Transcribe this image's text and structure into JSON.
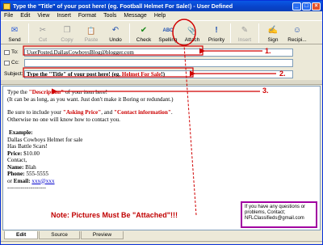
{
  "window": {
    "title": "Type the \"Title\" of your post here! (eg. Football Helmet For Sale!) - User Defined",
    "buttons": [
      "_",
      "□",
      "×"
    ]
  },
  "menu": [
    "File",
    "Edit",
    "View",
    "Insert",
    "Format",
    "Tools",
    "Message",
    "Help"
  ],
  "toolbar": [
    {
      "label": "Send",
      "icon": "send-icon",
      "glyph": "✉"
    },
    {
      "label": "Cut",
      "icon": "scissors-icon",
      "glyph": "✂",
      "disabled": true
    },
    {
      "label": "Copy",
      "icon": "copy-icon",
      "glyph": "❐",
      "disabled": true
    },
    {
      "label": "Paste",
      "icon": "paste-icon",
      "glyph": "📋",
      "disabled": true
    },
    {
      "label": "Undo",
      "icon": "undo-icon",
      "glyph": "↶"
    },
    {
      "label": "Check",
      "icon": "check-names-icon",
      "glyph": "✔"
    },
    {
      "label": "Spelling",
      "icon": "spelling-icon",
      "glyph": "ABC"
    },
    {
      "label": "Attach",
      "icon": "paperclip-icon",
      "glyph": "📎"
    },
    {
      "label": "Priority",
      "icon": "priority-icon",
      "glyph": "!"
    },
    {
      "label": "Insert",
      "icon": "insert-icon",
      "glyph": "✎",
      "disabled": true
    },
    {
      "label": "Sign",
      "icon": "sign-icon",
      "glyph": "✍"
    },
    {
      "label": "Recipi...",
      "icon": "recipients-icon",
      "glyph": "☺"
    }
  ],
  "headers": {
    "to_label": "To:",
    "to_value": "UserPosted.DallasCowboysBlog@blogger.com",
    "cc_label": "Cc:",
    "cc_value": "",
    "subject_label": "Subject:",
    "subject_value_pre": "Type the \"Title\" of your post here! (eg. ",
    "subject_value_red": "Helmet For Sale",
    "subject_value_post": "!)"
  },
  "body": {
    "l1_pre": "Type the ",
    "l1_red": "\"Description\"",
    "l1_post": " of your item here!",
    "l2": "(It can be as long, as you want. Just don't make it Boring or redundant.)",
    "l3_pre": "Be sure to include your ",
    "l3_red1": "\"Asking Price\"",
    "l3_mid": ", and ",
    "l3_red2": "\"Contact information\"",
    "l3_post": ".",
    "l4": "Otherwise no one will know how to contact you.",
    "example_label": "Example:",
    "ex1": "Dallas Cowboys Helmet for sale",
    "ex2": "Has Battle Scars!",
    "price_label": "Price:",
    "price_value": " $10.00",
    "contact": "Contact,",
    "name_label": "Name:",
    "name_value": " Blah",
    "phone_label": "Phone:",
    "phone_value": " 555-5555",
    "or_email": "or ",
    "email_label": "Email:",
    "email_value": "xxx@xxx",
    "divider": "--------------------"
  },
  "note": {
    "label": "Note:",
    "text": " Pictures Must Be \"Attached\"!!!"
  },
  "infobox": {
    "line1": "If you have any questions or",
    "line2": "problems, Contact;",
    "line3": "NFLClassifieds@gmail.com"
  },
  "annotations": [
    "1.",
    "2.",
    "3."
  ],
  "tabs": [
    "Edit",
    "Source",
    "Preview"
  ],
  "colors": {
    "annotation_red": "#d00000",
    "infobox_border": "#a100a1",
    "titlebar": "#0842c8"
  }
}
